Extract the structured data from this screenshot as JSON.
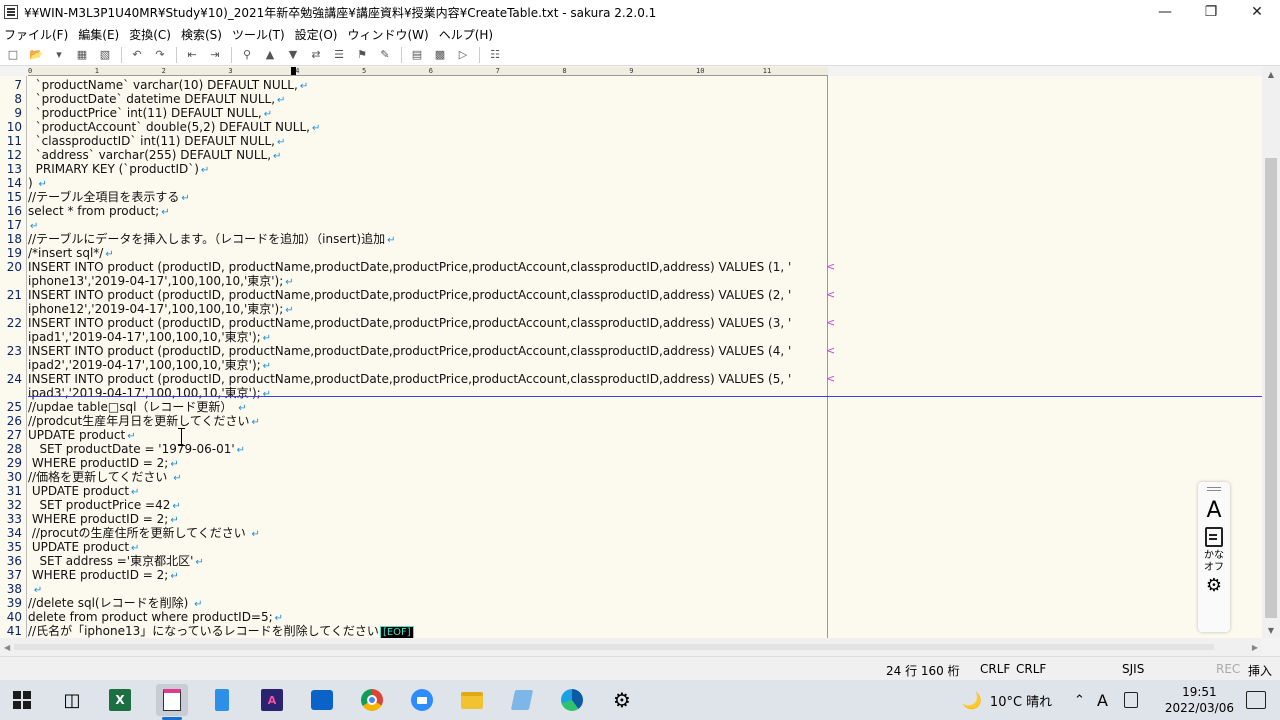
{
  "window": {
    "title": "¥¥WIN-M3L3P1U40MR¥Study¥10)_2021年新卒勉強講座¥講座資料¥授業内容¥CreateTable.txt - sakura 2.2.0.1",
    "minimize": "—",
    "maximize": "❐",
    "close": "✕"
  },
  "menu": [
    "ファイル(F)",
    "編集(E)",
    "変換(C)",
    "検索(S)",
    "ツール(T)",
    "設定(O)",
    "ウィンドウ(W)",
    "ヘルプ(H)"
  ],
  "ruler": [
    "0",
    "1",
    "2",
    "3",
    "4",
    "5",
    "6",
    "7",
    "8",
    "9",
    "10",
    "11"
  ],
  "editor": {
    "lines": [
      {
        "n": "7",
        "t": "  `productName` varchar(10) DEFAULT NULL,",
        "nl": true
      },
      {
        "n": "8",
        "t": "  `productDate` datetime DEFAULT NULL,",
        "nl": true
      },
      {
        "n": "9",
        "t": "  `productPrice` int(11) DEFAULT NULL,",
        "nl": true
      },
      {
        "n": "10",
        "t": "  `productAccount` double(5,2) DEFAULT NULL,",
        "nl": true
      },
      {
        "n": "11",
        "t": "  `classproductID` int(11) DEFAULT NULL,",
        "nl": true
      },
      {
        "n": "12",
        "t": "  `address` varchar(255) DEFAULT NULL,",
        "nl": true
      },
      {
        "n": "13",
        "t": "  PRIMARY KEY (`productID`)",
        "nl": true
      },
      {
        "n": "14",
        "t": ") ",
        "nl": true
      },
      {
        "n": "15",
        "t": "//テーブル全項目を表示する",
        "nl": true
      },
      {
        "n": "16",
        "t": "select * from product;",
        "nl": true
      },
      {
        "n": "17",
        "t": "",
        "nl": true
      },
      {
        "n": "18",
        "t": "//テーブルにデータを挿入します。（レコードを追加）（insert)追加",
        "nl": true
      },
      {
        "n": "19",
        "t": "/*insert sql*/",
        "nl": true
      },
      {
        "n": "20",
        "t": "INSERT INTO product (productID, productName,productDate,productPrice,productAccount,classproductID,address) VALUES (1, '",
        "wrap": true
      },
      {
        "n": "",
        "t": "iphone13','2019-04-17',100,100,10,'東京');",
        "nl": true
      },
      {
        "n": "21",
        "t": "INSERT INTO product (productID, productName,productDate,productPrice,productAccount,classproductID,address) VALUES (2, '",
        "wrap": true
      },
      {
        "n": "",
        "t": "iphone12','2019-04-17',100,100,10,'東京');",
        "nl": true
      },
      {
        "n": "22",
        "t": "INSERT INTO product (productID, productName,productDate,productPrice,productAccount,classproductID,address) VALUES (3, '",
        "wrap": true
      },
      {
        "n": "",
        "t": "ipad1','2019-04-17',100,100,10,'東京');",
        "nl": true
      },
      {
        "n": "23",
        "t": "INSERT INTO product (productID, productName,productDate,productPrice,productAccount,classproductID,address) VALUES (4, '",
        "wrap": true
      },
      {
        "n": "",
        "t": "ipad2','2019-04-17',100,100,10,'東京');",
        "nl": true
      },
      {
        "n": "24",
        "t": "INSERT INTO product (productID, productName,productDate,productPrice,productAccount,classproductID,address) VALUES (5, '",
        "wrap": true
      },
      {
        "n": "",
        "t": "ipad3','2019-04-17',100,100,10,'東京');",
        "nl": true
      },
      {
        "n": "25",
        "t": "//updae table□sql（レコード更新） ",
        "nl": true
      },
      {
        "n": "26",
        "t": "//prodcut生産年月日を更新してください",
        "nl": true
      },
      {
        "n": "27",
        "t": "UPDATE product",
        "nl": true
      },
      {
        "n": "28",
        "t": "   SET productDate = '1979-06-01'",
        "nl": true
      },
      {
        "n": "29",
        "t": " WHERE productID = 2;",
        "nl": true
      },
      {
        "n": "30",
        "t": "//価格を更新してください ",
        "nl": true
      },
      {
        "n": "31",
        "t": " UPDATE product",
        "nl": true
      },
      {
        "n": "32",
        "t": "   SET productPrice =42",
        "nl": true
      },
      {
        "n": "33",
        "t": " WHERE productID = 2;",
        "nl": true
      },
      {
        "n": "34",
        "t": " //procutの生産住所を更新してください ",
        "nl": true
      },
      {
        "n": "35",
        "t": " UPDATE product",
        "nl": true
      },
      {
        "n": "36",
        "t": "   SET address ='東京都北区'",
        "nl": true
      },
      {
        "n": "37",
        "t": " WHERE productID = 2;",
        "nl": true
      },
      {
        "n": "38",
        "t": " ",
        "nl": true
      },
      {
        "n": "39",
        "t": "//delete sql(レコードを削除) ",
        "nl": true
      },
      {
        "n": "40",
        "t": "delete from product where productID=5;",
        "nl": true
      },
      {
        "n": "41",
        "t": "//氏名が「iphone13」になっているレコードを削除してください",
        "eof": true
      }
    ],
    "newline_mark": "↵",
    "wrap_mark": "<",
    "eof_mark": "[EOF]"
  },
  "ime": {
    "mode": "A",
    "kana_line1": "かな",
    "kana_line2": "オフ"
  },
  "status": {
    "position": "24 行  160 桁",
    "newline1": "CRLF",
    "newline2": "CRLF",
    "encoding": "SJIS",
    "rec": "REC",
    "insert": "挿入"
  },
  "taskbar": {
    "weather": "10°C  晴れ",
    "ime": "A",
    "time": "19:51",
    "date": "2022/03/06"
  }
}
